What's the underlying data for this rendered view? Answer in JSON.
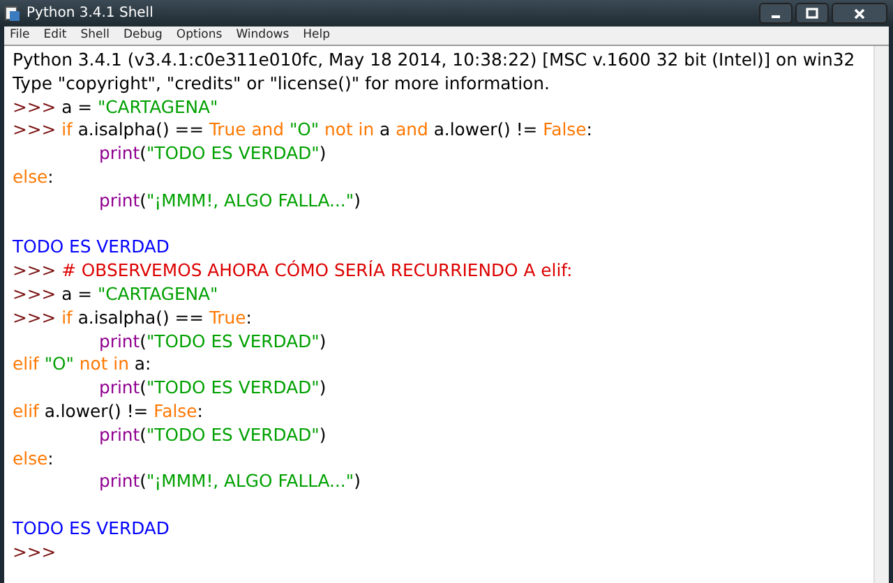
{
  "window": {
    "title": "Python 3.4.1 Shell"
  },
  "menu": [
    "File",
    "Edit",
    "Shell",
    "Debug",
    "Options",
    "Windows",
    "Help"
  ],
  "lines": [
    {
      "kind": "code",
      "indent": false,
      "tokens": [
        {
          "kind": "plain",
          "text": "Python 3.4.1 (v3.4.1:c0e311e010fc, May 18 2014, 10:38:22) [MSC v.1600 32 bit (Intel)] on win32"
        }
      ]
    },
    {
      "kind": "code",
      "indent": false,
      "tokens": [
        {
          "kind": "plain",
          "text": "Type \"copyright\", \"credits\" or \"license()\" for more information."
        }
      ]
    },
    {
      "kind": "code",
      "indent": false,
      "tokens": [
        {
          "kind": "prompt",
          "text": ">>> "
        },
        {
          "kind": "plain",
          "text": "a = "
        },
        {
          "kind": "string",
          "text": "\"CARTAGENA\""
        }
      ]
    },
    {
      "kind": "code",
      "indent": false,
      "tokens": [
        {
          "kind": "prompt",
          "text": ">>> "
        },
        {
          "kind": "keyword",
          "text": "if "
        },
        {
          "kind": "plain",
          "text": "a.isalpha() == "
        },
        {
          "kind": "keyword",
          "text": "True and "
        },
        {
          "kind": "string",
          "text": "\"O\" "
        },
        {
          "kind": "keyword",
          "text": "not in "
        },
        {
          "kind": "plain",
          "text": "a "
        },
        {
          "kind": "keyword",
          "text": "and "
        },
        {
          "kind": "plain",
          "text": "a.lower() != "
        },
        {
          "kind": "keyword",
          "text": "False"
        },
        {
          "kind": "plain",
          "text": ":"
        }
      ]
    },
    {
      "kind": "code",
      "indent": true,
      "tokens": [
        {
          "kind": "builtin",
          "text": "print"
        },
        {
          "kind": "plain",
          "text": "("
        },
        {
          "kind": "string",
          "text": "\"TODO ES VERDAD\""
        },
        {
          "kind": "plain",
          "text": ")"
        }
      ]
    },
    {
      "kind": "code",
      "indent": false,
      "tokens": [
        {
          "kind": "keyword",
          "text": "else"
        },
        {
          "kind": "plain",
          "text": ":"
        }
      ]
    },
    {
      "kind": "code",
      "indent": true,
      "tokens": [
        {
          "kind": "builtin",
          "text": "print"
        },
        {
          "kind": "plain",
          "text": "("
        },
        {
          "kind": "string",
          "text": "\"¡MMM!, ALGO FALLA...\""
        },
        {
          "kind": "plain",
          "text": ")"
        }
      ]
    },
    {
      "kind": "blank"
    },
    {
      "kind": "code",
      "indent": false,
      "tokens": [
        {
          "kind": "output",
          "text": "TODO ES VERDAD"
        }
      ]
    },
    {
      "kind": "code",
      "indent": false,
      "tokens": [
        {
          "kind": "prompt",
          "text": ">>> "
        },
        {
          "kind": "comment",
          "text": "# OBSERVEMOS AHORA CÓMO SERÍA RECURRIENDO A elif:"
        }
      ]
    },
    {
      "kind": "code",
      "indent": false,
      "tokens": [
        {
          "kind": "prompt",
          "text": ">>> "
        },
        {
          "kind": "plain",
          "text": "a = "
        },
        {
          "kind": "string",
          "text": "\"CARTAGENA\""
        }
      ]
    },
    {
      "kind": "code",
      "indent": false,
      "tokens": [
        {
          "kind": "prompt",
          "text": ">>> "
        },
        {
          "kind": "keyword",
          "text": "if "
        },
        {
          "kind": "plain",
          "text": "a.isalpha() == "
        },
        {
          "kind": "keyword",
          "text": "True"
        },
        {
          "kind": "plain",
          "text": ":"
        }
      ]
    },
    {
      "kind": "code",
      "indent": true,
      "tokens": [
        {
          "kind": "builtin",
          "text": "print"
        },
        {
          "kind": "plain",
          "text": "("
        },
        {
          "kind": "string",
          "text": "\"TODO ES VERDAD\""
        },
        {
          "kind": "plain",
          "text": ")"
        }
      ]
    },
    {
      "kind": "code",
      "indent": false,
      "tokens": [
        {
          "kind": "keyword",
          "text": "elif "
        },
        {
          "kind": "string",
          "text": "\"O\" "
        },
        {
          "kind": "keyword",
          "text": "not in "
        },
        {
          "kind": "plain",
          "text": "a:"
        }
      ]
    },
    {
      "kind": "code",
      "indent": true,
      "tokens": [
        {
          "kind": "builtin",
          "text": "print"
        },
        {
          "kind": "plain",
          "text": "("
        },
        {
          "kind": "string",
          "text": "\"TODO ES VERDAD\""
        },
        {
          "kind": "plain",
          "text": ")"
        }
      ]
    },
    {
      "kind": "code",
      "indent": false,
      "tokens": [
        {
          "kind": "keyword",
          "text": "elif "
        },
        {
          "kind": "plain",
          "text": "a.lower() != "
        },
        {
          "kind": "keyword",
          "text": "False"
        },
        {
          "kind": "plain",
          "text": ":"
        }
      ]
    },
    {
      "kind": "code",
      "indent": true,
      "tokens": [
        {
          "kind": "builtin",
          "text": "print"
        },
        {
          "kind": "plain",
          "text": "("
        },
        {
          "kind": "string",
          "text": "\"TODO ES VERDAD\""
        },
        {
          "kind": "plain",
          "text": ")"
        }
      ]
    },
    {
      "kind": "code",
      "indent": false,
      "tokens": [
        {
          "kind": "keyword",
          "text": "else"
        },
        {
          "kind": "plain",
          "text": ":"
        }
      ]
    },
    {
      "kind": "code",
      "indent": true,
      "tokens": [
        {
          "kind": "builtin",
          "text": "print"
        },
        {
          "kind": "plain",
          "text": "("
        },
        {
          "kind": "string",
          "text": "\"¡MMM!, ALGO FALLA...\""
        },
        {
          "kind": "plain",
          "text": ")"
        }
      ]
    },
    {
      "kind": "blank"
    },
    {
      "kind": "code",
      "indent": false,
      "tokens": [
        {
          "kind": "output",
          "text": "TODO ES VERDAD"
        }
      ]
    },
    {
      "kind": "code",
      "indent": false,
      "tokens": [
        {
          "kind": "prompt",
          "text": ">>>"
        }
      ]
    }
  ]
}
